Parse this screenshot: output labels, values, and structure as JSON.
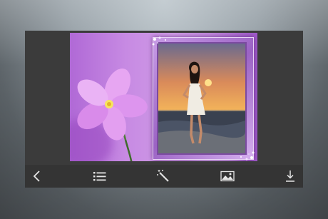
{
  "screen": {
    "title": ""
  },
  "editor": {
    "background_image": "purple-flower-photo",
    "frame_style": "purple-sparkle-frame",
    "photo": "woman-on-beach-at-sunset"
  },
  "toolbar": {
    "items": [
      {
        "icon": "chevron-left-icon",
        "action": "back"
      },
      {
        "icon": "list-icon",
        "action": "frames"
      },
      {
        "icon": "magic-wand-icon",
        "action": "effects"
      },
      {
        "icon": "image-icon",
        "action": "change-photo"
      },
      {
        "icon": "download-icon",
        "action": "save"
      }
    ]
  },
  "colors": {
    "toolbar_bg": "#343434",
    "panel_bg": "#3b3b3b",
    "accent_purple": "#b069d6",
    "icon_color": "#e6e6e6"
  }
}
